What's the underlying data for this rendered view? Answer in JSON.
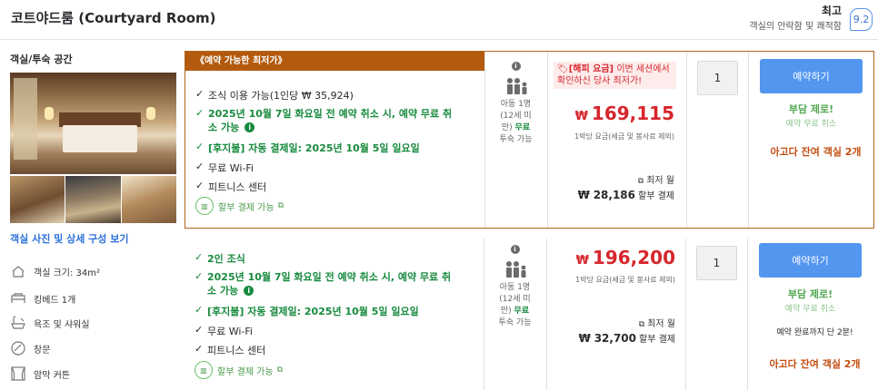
{
  "header": {
    "room_title": "코트야드룸 (Courtyard Room)",
    "rating_word": "최고",
    "rating_desc": "객실의 안락함 및 쾌적함",
    "score": "9.2"
  },
  "sidebar": {
    "space_title": "객실/투숙 공간",
    "view_link": "객실 사진 및 상세 구성 보기",
    "features": [
      {
        "label": "객실 크기: 34m²",
        "icon": "room-size-icon"
      },
      {
        "label": "킹베드 1개",
        "icon": "bed-icon"
      },
      {
        "label": "욕조 및 샤워실",
        "icon": "bath-icon"
      },
      {
        "label": "창문",
        "icon": "window-icon"
      },
      {
        "label": "암막 커튼",
        "icon": "curtain-icon"
      }
    ]
  },
  "offers": [
    {
      "ribbon": "《예약 가능한 최저가》",
      "amenities": [
        {
          "text": "조식 이용 가능(1인당 ₩ 35,924)",
          "green": false
        },
        {
          "text": "2025년 10월 7일 화요일 전 예약 취소 시, 예약 무료 취소 가능",
          "green": true
        },
        {
          "text": "[후지불] 자동 결제일: 2025년 10월 5일 일요일",
          "green": true
        },
        {
          "text": "무료 Wi-Fi",
          "green": false
        },
        {
          "text": "피트니스 센터",
          "green": false
        }
      ],
      "installment": "할부 결제 가능",
      "occupancy": {
        "line1": "아동 1명",
        "line2": "(12세 미",
        "line3": "만)",
        "free": "무료",
        "line4": "투숙 가능"
      },
      "promo": {
        "tag": "[해피 요금]",
        "text": " 이번 세션에서 확인하신 당사 최저가!"
      },
      "currency": "₩",
      "price": "169,115",
      "price_note": "1박당 요금(세금 및 봉사료 제외)",
      "monthly_label": "최저 월",
      "monthly_currency": "₩",
      "monthly_amount": "28,186",
      "monthly_suffix": "할부 결제",
      "qty": "1",
      "reserve_label": "예약하기",
      "no_risk": "부담 제로!",
      "no_risk_sub": "예약 무료 취소",
      "last_rooms": "아고다 잔여 객실 2개"
    },
    {
      "amenities": [
        {
          "text": "2인 조식",
          "green": true
        },
        {
          "text": "2025년 10월 7일 화요일 전 예약 취소 시, 예약 무료 취소 가능",
          "green": true
        },
        {
          "text": "[후지불] 자동 결제일: 2025년 10월 5일 일요일",
          "green": true
        },
        {
          "text": "무료 Wi-Fi",
          "green": false
        },
        {
          "text": "피트니스 센터",
          "green": false
        }
      ],
      "installment": "할부 결제 가능",
      "occupancy": {
        "line1": "아동 1명",
        "line2": "(12세 미",
        "line3": "만)",
        "free": "무료",
        "line4": "투숙 가능"
      },
      "currency": "₩",
      "price": "196,200",
      "price_note": "1박당 요금(세금 및 봉사료 제외)",
      "monthly_label": "최저 월",
      "monthly_currency": "₩",
      "monthly_amount": "32,700",
      "monthly_suffix": "할부 결제",
      "qty": "1",
      "reserve_label": "예약하기",
      "no_risk": "부담 제로!",
      "no_risk_sub": "예약 무료 취소",
      "hurry": "예약 완료까지 단 2분!",
      "last_rooms": "아고다 잔여 객실 2개"
    }
  ],
  "colors": {
    "accent": "#5396f0",
    "deal": "#b35a0e",
    "price": "#d6262c",
    "green": "#178a3e"
  }
}
